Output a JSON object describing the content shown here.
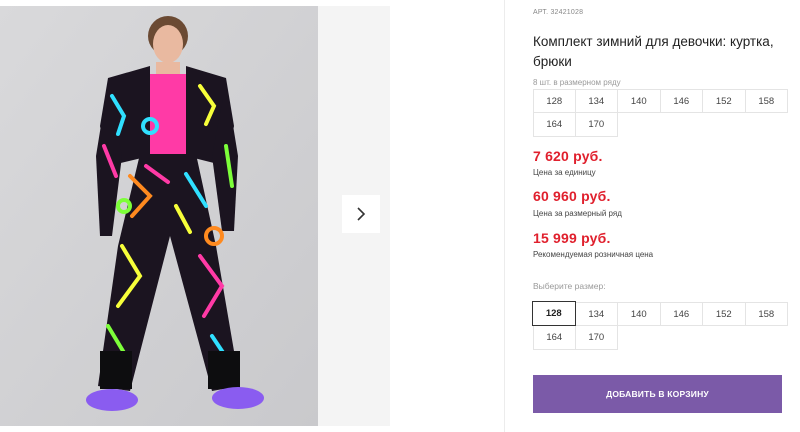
{
  "product": {
    "sku_label": "АРТ.",
    "sku_value": "32421028",
    "title": "Комплект зимний для девочки: куртка, брюки"
  },
  "size_row": {
    "hint": "8 шт. в размерном ряду",
    "sizes": [
      "128",
      "134",
      "140",
      "146",
      "152",
      "158",
      "164",
      "170"
    ]
  },
  "prices": {
    "unit_price": "7 620 руб.",
    "unit_note": "Цена за единицу",
    "row_price": "60 960 руб.",
    "row_note": "Цена за размерный ряд",
    "retail_price": "15 999 руб.",
    "retail_note": "Рекомендуемая розничная цена"
  },
  "size_select": {
    "label": "Выберите размер:",
    "sizes": [
      "128",
      "134",
      "140",
      "146",
      "152",
      "158",
      "164",
      "170"
    ],
    "selected": "128"
  },
  "cart_button": {
    "label": "ДОБАВИТЬ В КОРЗИНУ"
  },
  "colors": {
    "price": "#e0202d",
    "button": "#7b5aa8"
  },
  "gallery": {
    "next_icon": "chevron-right-icon"
  }
}
